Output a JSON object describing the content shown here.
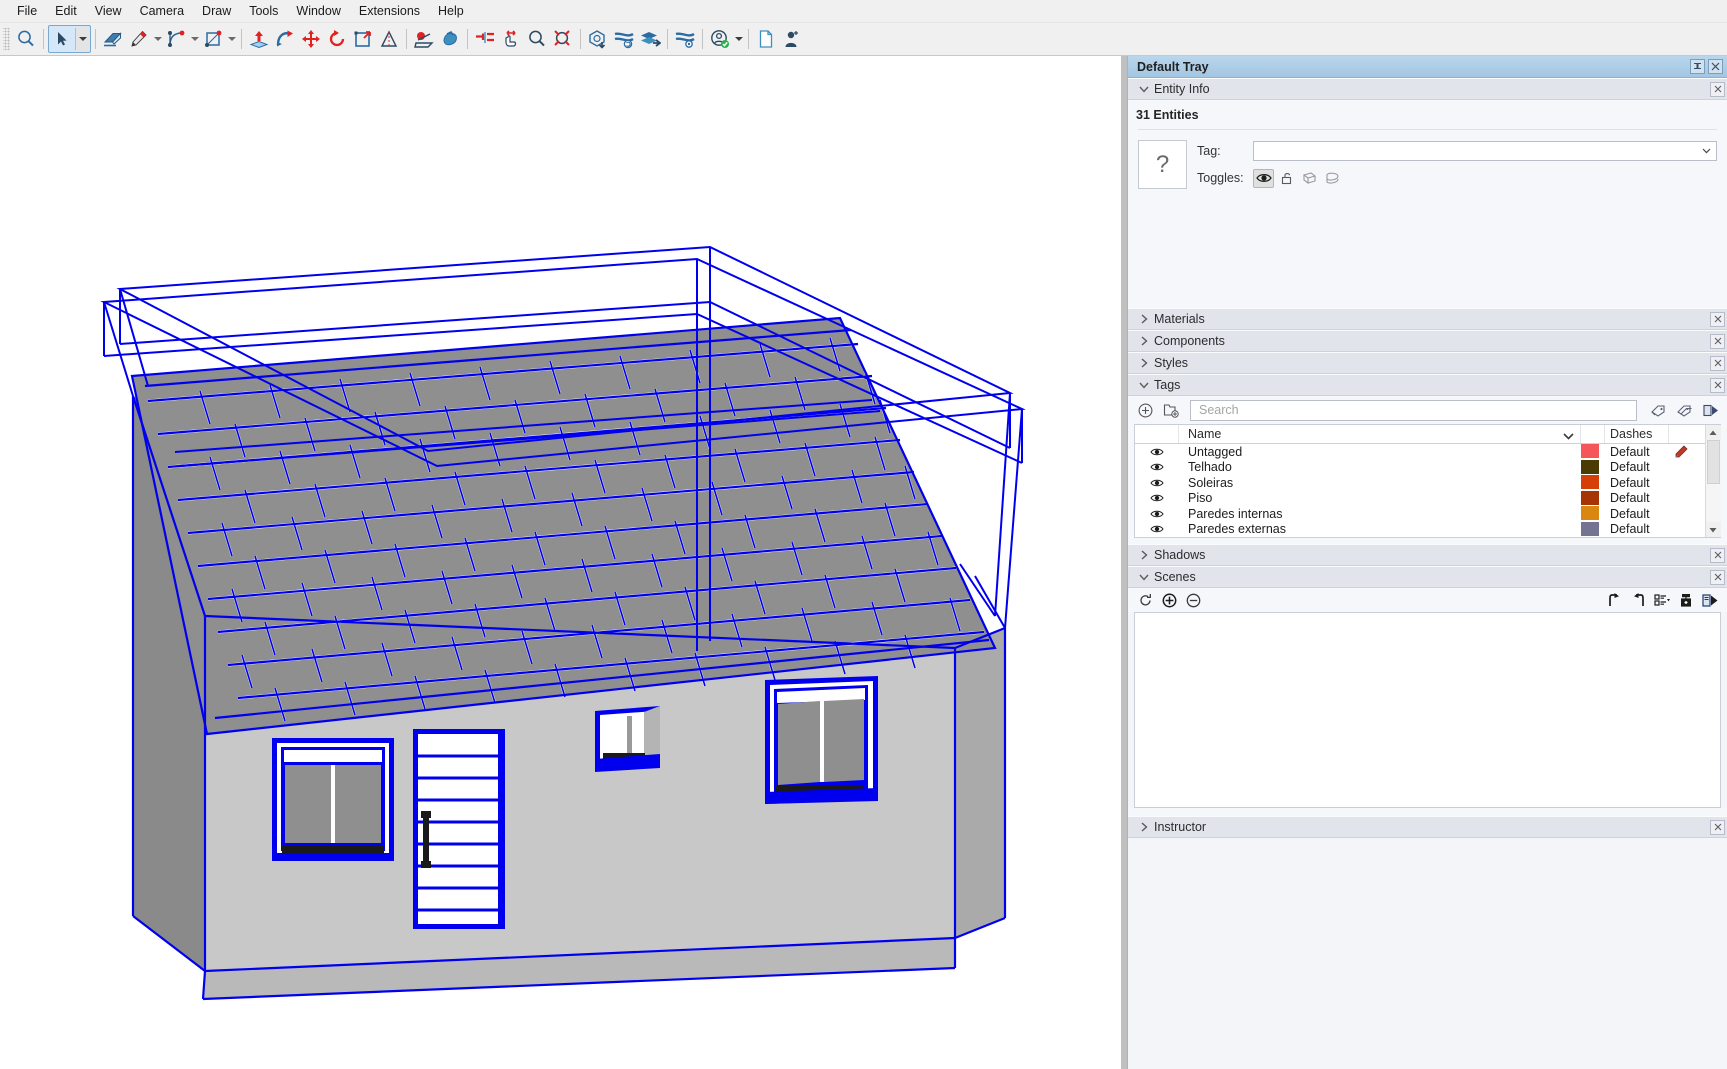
{
  "menu": {
    "items": [
      "File",
      "Edit",
      "View",
      "Camera",
      "Draw",
      "Tools",
      "Window",
      "Extensions",
      "Help"
    ]
  },
  "toolbar": {
    "tools": [
      {
        "name": "zoom-magnifier-icon",
        "title": "Zoom"
      },
      {
        "name": "select-arrow-icon",
        "title": "Select",
        "active": true
      },
      {
        "name": "eraser-icon",
        "title": "Eraser"
      },
      {
        "name": "pencil-line-icon",
        "title": "Line"
      },
      {
        "name": "arc-icon",
        "title": "Arc"
      },
      {
        "name": "rectangle-icon",
        "title": "Rectangle"
      },
      {
        "name": "push-pull-icon",
        "title": "Push/Pull"
      },
      {
        "name": "follow-me-icon",
        "title": "Follow Me"
      },
      {
        "name": "move-icon",
        "title": "Move"
      },
      {
        "name": "rotate-icon",
        "title": "Rotate"
      },
      {
        "name": "scale-icon",
        "title": "Scale"
      },
      {
        "name": "tape-measure-icon",
        "title": "Tape Measure"
      },
      {
        "name": "orbit-icon",
        "title": "Orbit"
      },
      {
        "name": "pan-icon",
        "title": "Pan"
      },
      {
        "name": "section-plane-icon",
        "title": "Section Plane"
      },
      {
        "name": "position-camera-icon",
        "title": "Position Camera"
      },
      {
        "name": "zoom-tool-icon",
        "title": "Zoom Tool"
      },
      {
        "name": "zoom-extents-icon",
        "title": "Zoom Extents"
      },
      {
        "name": "model-info-icon",
        "title": "Model Info"
      },
      {
        "name": "sync-recent-icon",
        "title": "Sync"
      },
      {
        "name": "layers-send-icon",
        "title": "Send Layers"
      },
      {
        "name": "settings-sync-icon",
        "title": "Sync Settings"
      },
      {
        "name": "account-icon",
        "title": "Account"
      },
      {
        "name": "new-document-icon",
        "title": "New"
      },
      {
        "name": "person-add-icon",
        "title": "Add Person"
      }
    ]
  },
  "tray": {
    "title": "Default Tray",
    "pin_label": "⚑",
    "close_label": "×"
  },
  "entity_info": {
    "header": "Entity Info",
    "count": "31 Entities",
    "thumb_glyph": "?",
    "tag_label": "Tag:",
    "tag_value": "",
    "toggles_label": "Toggles:",
    "toggles": [
      {
        "name": "visibility-eye-icon",
        "state": "on"
      },
      {
        "name": "unlocked-padlock-icon",
        "state": "off"
      },
      {
        "name": "receives-shadow-icon",
        "state": "off"
      },
      {
        "name": "casts-shadow-icon",
        "state": "off"
      }
    ]
  },
  "panels": [
    {
      "label": "Materials",
      "name": "materials"
    },
    {
      "label": "Components",
      "name": "components"
    },
    {
      "label": "Styles",
      "name": "styles"
    }
  ],
  "tags": {
    "header": "Tags",
    "search_placeholder": "Search",
    "search_value": "",
    "toolbar_icons": [
      {
        "name": "add-tag-icon"
      },
      {
        "name": "add-tag-folder-icon"
      },
      {
        "name": "tag-pencil-icon"
      },
      {
        "name": "tag-label-icon"
      },
      {
        "name": "tag-export-icon"
      }
    ],
    "columns": {
      "eye": "",
      "name": "Name",
      "color": "",
      "dashes": "Dashes"
    },
    "rows": [
      {
        "name": "Untagged",
        "visible": true,
        "color": "#f4565a",
        "dashes": "Default",
        "edit": true
      },
      {
        "name": "Telhado",
        "visible": true,
        "color": "#4a3b05",
        "dashes": "Default",
        "edit": false
      },
      {
        "name": "Soleiras",
        "visible": true,
        "color": "#d63e08",
        "dashes": "Default",
        "edit": false
      },
      {
        "name": "Piso",
        "visible": true,
        "color": "#a73404",
        "dashes": "Default",
        "edit": false
      },
      {
        "name": "Paredes internas",
        "visible": true,
        "color": "#d98711",
        "dashes": "Default",
        "edit": false
      },
      {
        "name": "Paredes externas",
        "visible": true,
        "color": "#727491",
        "dashes": "Default",
        "edit": false
      }
    ]
  },
  "shadows": {
    "header": "Shadows"
  },
  "scenes": {
    "header": "Scenes",
    "toolbar_icons": [
      {
        "name": "refresh-scene-icon"
      },
      {
        "name": "add-scene-icon"
      },
      {
        "name": "remove-scene-icon"
      },
      {
        "name": "move-scene-up-icon"
      },
      {
        "name": "move-scene-down-icon"
      },
      {
        "name": "scene-view-options-icon"
      },
      {
        "name": "scene-details-icon"
      },
      {
        "name": "scene-export-icon"
      }
    ],
    "items": []
  },
  "instructor": {
    "header": "Instructor"
  },
  "viewport": {
    "name": "sketchup-3d-model-viewport",
    "model_description": "Selected blue-highlighted house model with tiled roof, door and windows",
    "colors": {
      "selection": "#0000ee",
      "wall": "#c8c8c8",
      "wall_shadow": "#8c8c8c",
      "roof_tile": "#8a8a8a",
      "roof_grout": "#ffffff",
      "glass": "#9a9a9a",
      "background": "#ffffff"
    }
  }
}
